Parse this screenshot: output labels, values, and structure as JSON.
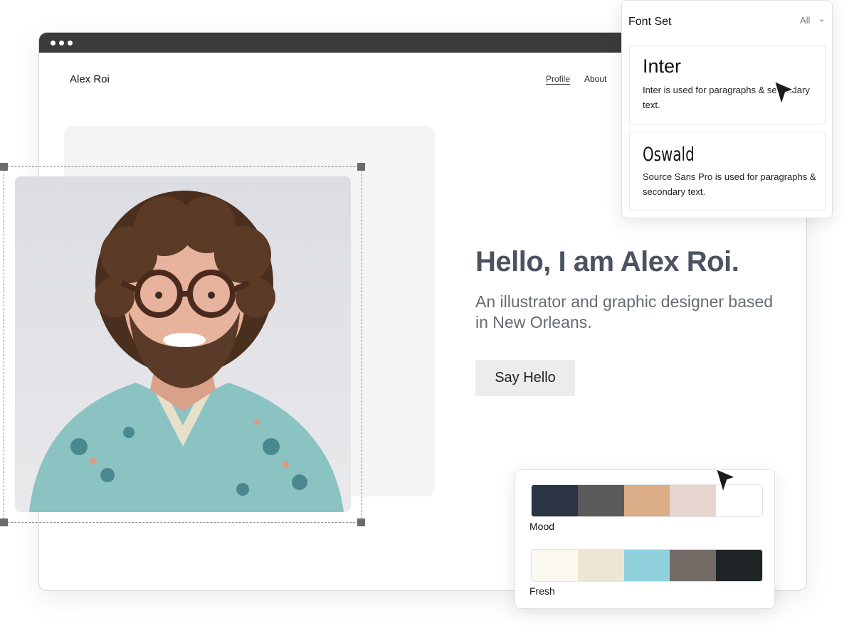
{
  "site": {
    "brand": "Alex Roi",
    "nav": [
      {
        "label": "Profile",
        "active": true
      },
      {
        "label": "About",
        "active": false
      }
    ]
  },
  "hero": {
    "title": "Hello, I am Alex Roi.",
    "subtitle": "An illustrator and graphic designer based in New Orleans.",
    "cta_label": "Say Hello"
  },
  "font_panel": {
    "title": "Font Set",
    "filter": "All",
    "fonts": [
      {
        "name": "Inter",
        "description": "Inter is used for paragraphs & secondary text."
      },
      {
        "name": "Oswald",
        "description": "Source Sans Pro is used for paragraphs & secondary text."
      }
    ]
  },
  "palettes": [
    {
      "name": "Mood",
      "colors": [
        "#2b3442",
        "#5c5b5b",
        "#dbad87",
        "#e6d5cf",
        "#ffffff"
      ]
    },
    {
      "name": "Fresh",
      "colors": [
        "#fbf9ef",
        "#ede5d4",
        "#8fd0dc",
        "#746a66",
        "#1f2427"
      ]
    }
  ],
  "icons": {
    "cursor_1": "pointer-cursor-icon",
    "cursor_2": "pointer-cursor-icon",
    "window_controls": "dots-icon",
    "filter_chevron": "chevron-down-icon"
  }
}
